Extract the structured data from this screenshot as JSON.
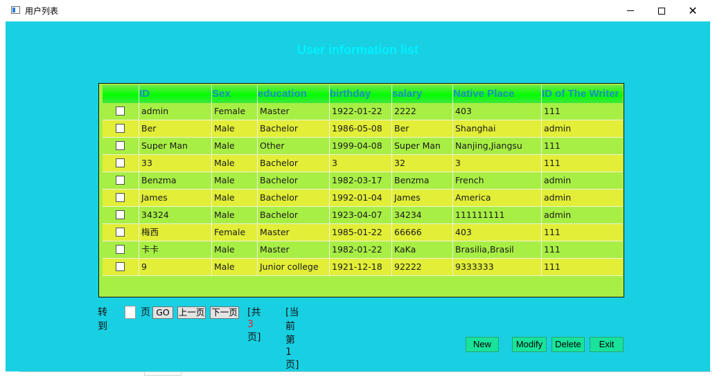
{
  "window": {
    "title": "用户列表"
  },
  "page": {
    "heading": "User information list"
  },
  "table": {
    "columns": [
      "ID",
      "Sex",
      "education",
      "birthday",
      "salary",
      "Native Place",
      "ID of The Writer"
    ],
    "rows": [
      [
        "admin",
        "Female",
        "Master",
        "1922-01-22",
        "2222",
        "403",
        "111"
      ],
      [
        "Ber",
        "Male",
        "Bachelor",
        "1986-05-08",
        "Ber",
        "Shanghai",
        "admin"
      ],
      [
        "Super Man",
        "Male",
        "Other",
        "1999-04-08",
        "Super Man",
        "Nanjing,Jiangsu",
        "111"
      ],
      [
        "33",
        "Male",
        "Bachelor",
        "3",
        "32",
        "3",
        "111"
      ],
      [
        "Benzma",
        "Male",
        "Bachelor",
        "1982-03-17",
        "Benzma",
        "French",
        "admin"
      ],
      [
        "James",
        "Male",
        "Bachelor",
        "1992-01-04",
        "James",
        "America",
        "admin"
      ],
      [
        "34324",
        "Male",
        "Bachelor",
        "1923-04-07",
        "34234",
        "111111111",
        "admin"
      ],
      [
        "梅西",
        "Female",
        "Master",
        "1985-01-22",
        "66666",
        "403",
        "111"
      ],
      [
        "卡卡",
        "Male",
        "Master",
        "1982-01-22",
        "KaKa",
        "Brasilia,Brasil",
        "111"
      ],
      [
        "9",
        "Male",
        "Junior college",
        "1921-12-18",
        "92222",
        "9333333",
        "111"
      ]
    ]
  },
  "pager": {
    "goto_label": "转到",
    "page_label": "页",
    "page_input": "",
    "go": "GO",
    "prev": "上一页",
    "next": "下一页",
    "total_prefix": "[共",
    "total_pages": "3",
    "total_suffix": "页]",
    "current": "[当前第1 页]"
  },
  "actions": {
    "new": "New",
    "modify": "Modify",
    "delete": "Delete",
    "exit": "Exit"
  },
  "colors": {
    "background": "#19d0e2",
    "heading": "#00f0ff",
    "header_text": "#1f8cc4",
    "row_green": "#a8ef45",
    "row_yellow": "#e2ee37",
    "button": "#19e39a"
  }
}
